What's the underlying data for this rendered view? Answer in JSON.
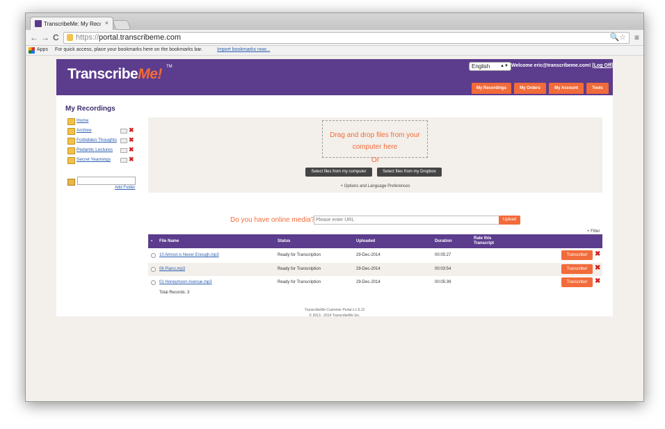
{
  "browser": {
    "tab_title": "TranscribeMe: My Recordi",
    "tab_close": "×",
    "url_prefix": "https://",
    "url_domain": "portal.transcribeme.com",
    "omnibox_right": "🔍☆",
    "menu_icon": "≡",
    "bookmarks": {
      "apps_label": "Apps",
      "hint": "For quick access, place your bookmarks here on the bookmarks bar.",
      "import_link": "Import bookmarks now..."
    },
    "nav": {
      "back": "←",
      "forward": "→",
      "reload": "C"
    }
  },
  "header": {
    "logo_main": "Transcribe",
    "logo_accent": "Me!",
    "logo_tm": "TM",
    "language": "English",
    "welcome_prefix": "Welcome eric@transcribeme.com! [",
    "logoff": "Log Off",
    "welcome_suffix": "]",
    "nav": [
      "My Recordings",
      "My Orders",
      "My Account",
      "Tools"
    ]
  },
  "sidebar": {
    "title": "My Recordings",
    "folders": [
      {
        "label": "Home"
      },
      {
        "label": "Archive"
      },
      {
        "label": "Forbidden Thoughts"
      },
      {
        "label": "Pedantic Lectures"
      },
      {
        "label": "Secret Yearnings"
      }
    ],
    "delete_glyph": "✖",
    "add_folder": "Add Folder"
  },
  "upload": {
    "drop_text": "Drag and drop files from your computer here",
    "or": "Or",
    "btn_computer": "Select files from my computer",
    "btn_dropbox": "Select files from my Dropbox",
    "options": "+ Options and Language Preferences",
    "online_label": "Do you have online media?",
    "url_placeholder": "Please enter URL",
    "upload_btn": "Upload",
    "filter": "+ Filter"
  },
  "table": {
    "columns": [
      "File Name",
      "Status",
      "Uploaded",
      "Duration",
      "Rate this Transcript"
    ],
    "rows": [
      {
        "file": "10 Almost is Never Enough.mp3",
        "status": "Ready for Transcription",
        "uploaded": "29-Dec-2014",
        "duration": "00:05:27"
      },
      {
        "file": "06 Piano.mp3",
        "status": "Ready for Transcription",
        "uploaded": "29-Dec-2014",
        "duration": "00:03:54"
      },
      {
        "file": "01 Honeymoon Avenue.mp3",
        "status": "Ready for Transcription",
        "uploaded": "29-Dec-2014",
        "duration": "00:05:39"
      }
    ],
    "transcribe_btn": "Transcribe!",
    "total": "Total Records: 3"
  },
  "footer": {
    "line1": "TranscribeMe Customer Portal v.1.6.12",
    "line2": "© 2013 - 2014 TranscribeMe Inc."
  },
  "colors": {
    "brand_purple": "#5c3c8d",
    "accent_orange": "#f26b3a",
    "link_blue": "#2a5db0"
  }
}
